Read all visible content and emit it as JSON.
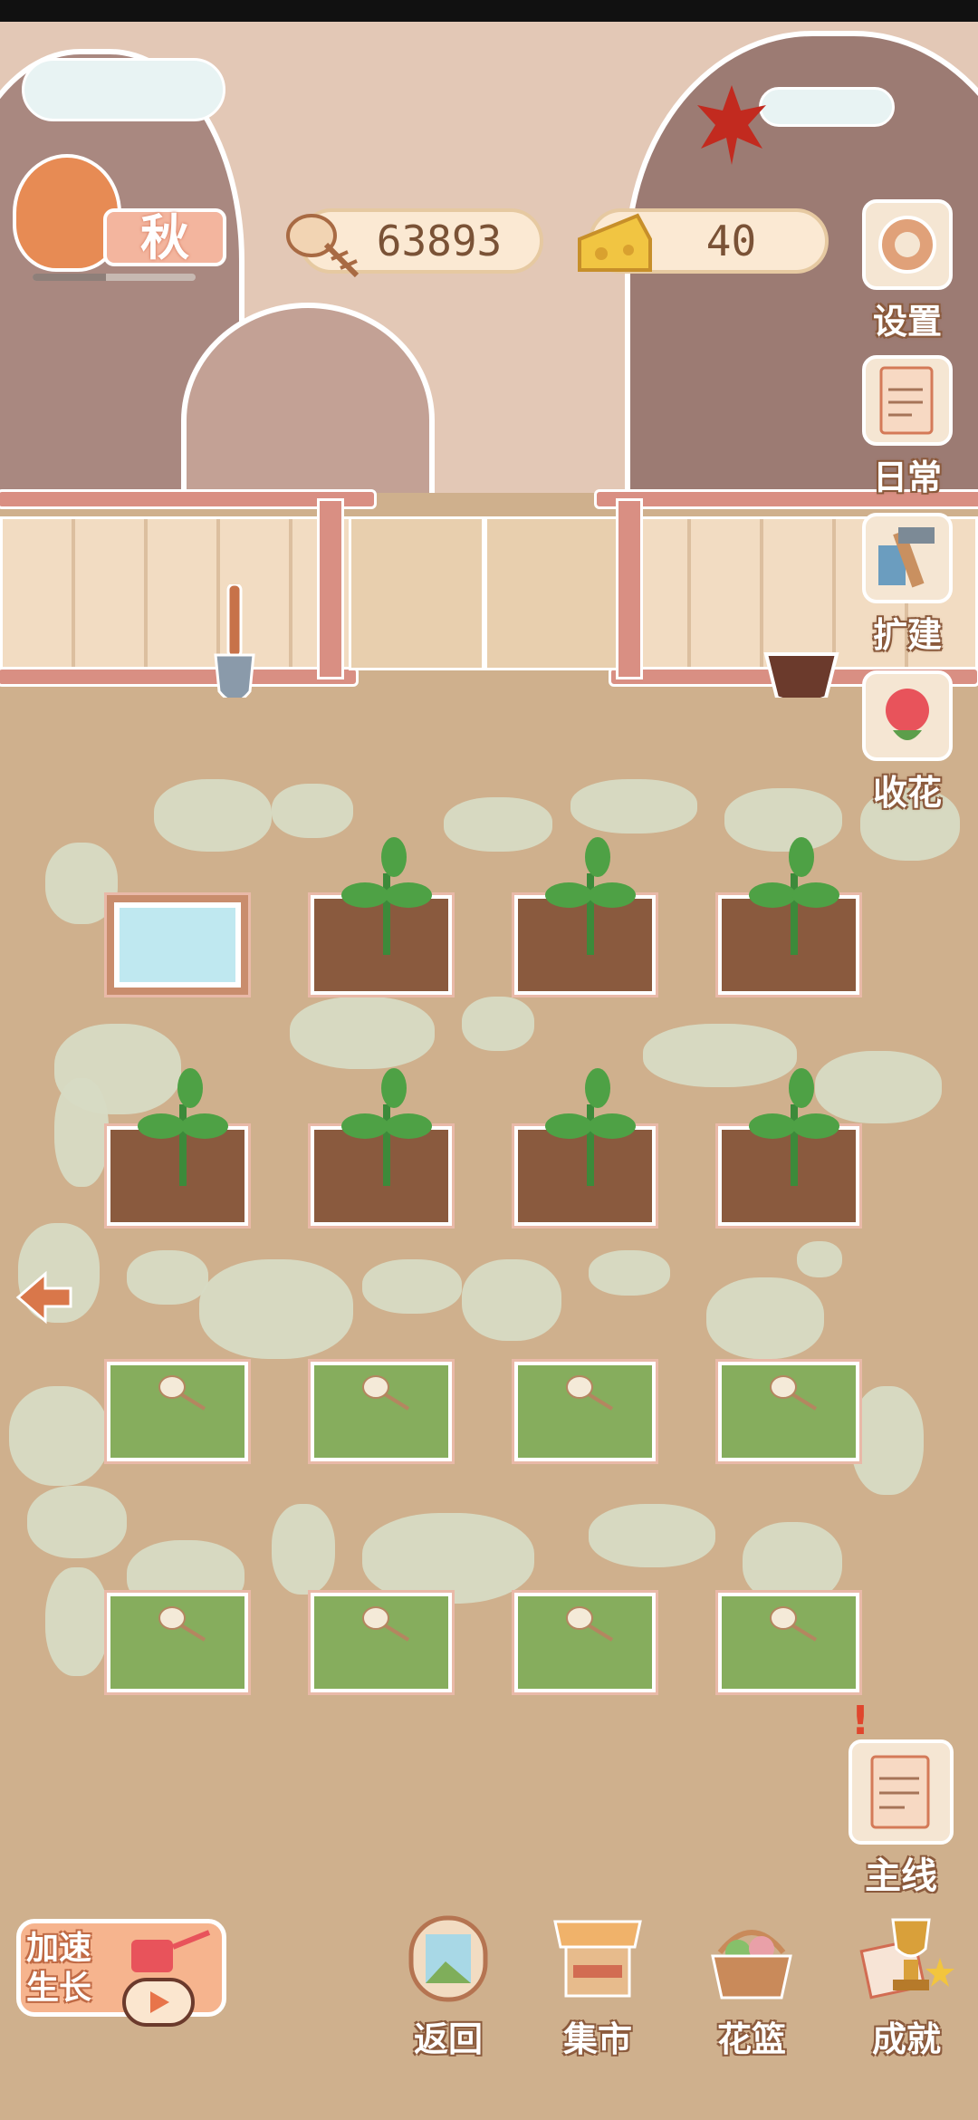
{
  "hud": {
    "season": "秋",
    "season_progress": 0.45,
    "fish_bones": "63893",
    "cheese": "40"
  },
  "side_menu": [
    {
      "label": "设置",
      "icon": "gear-icon"
    },
    {
      "label": "日常",
      "icon": "daily-tip-note-icon"
    },
    {
      "label": "扩建",
      "icon": "hammer-expand-icon"
    },
    {
      "label": "收花",
      "icon": "rose-harvest-icon"
    }
  ],
  "garden": {
    "rows": [
      [
        "water",
        "sprout",
        "sprout",
        "sprout"
      ],
      [
        "sprout",
        "sprout",
        "sprout",
        "sprout"
      ],
      [
        "fishbone",
        "fishbone",
        "fishbone",
        "fishbone"
      ],
      [
        "fishbone",
        "fishbone",
        "fishbone",
        "fishbone"
      ]
    ]
  },
  "quest": {
    "label": "主线",
    "alert": "!"
  },
  "speed_up": {
    "label": "加速生长"
  },
  "bottom_nav": [
    {
      "label": "返回",
      "icon": "window-return-icon"
    },
    {
      "label": "集市",
      "icon": "market-stall-icon"
    },
    {
      "label": "花篮",
      "icon": "flower-basket-icon"
    },
    {
      "label": "成就",
      "icon": "trophy-icon"
    }
  ],
  "colors": {
    "ground": "#cfb08d",
    "soil": "#8a5a3e",
    "grass": "#86ad5d",
    "accent": "#d98f83"
  }
}
